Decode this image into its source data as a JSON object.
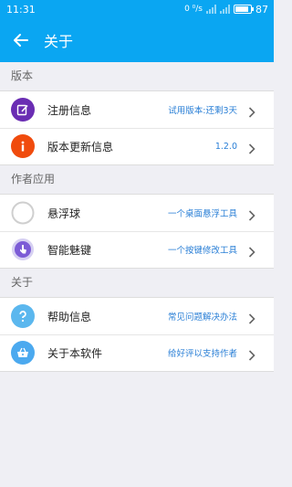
{
  "status_bar": {
    "time": "11:31",
    "net_speed": "0 ⁰/s",
    "battery": "87",
    "battery_level": 0.87
  },
  "app_bar": {
    "title": "关于"
  },
  "sections": [
    {
      "header": "版本",
      "items": [
        {
          "label": "注册信息",
          "value": "试用版本:还剩3天",
          "icon": "edit-icon",
          "color": "#6a2db3"
        },
        {
          "label": "版本更新信息",
          "value": "1.2.0",
          "icon": "info-icon",
          "color": "#f04b0d"
        }
      ]
    },
    {
      "header": "作者应用",
      "items": [
        {
          "label": "悬浮球",
          "value": "一个桌面悬浮工具",
          "icon": "floating-ball-icon",
          "color": "#d8d8d8"
        },
        {
          "label": "智能魅键",
          "value": "一个按键修改工具",
          "icon": "touch-key-icon",
          "color": "#7c5cd6"
        }
      ]
    },
    {
      "header": "关于",
      "items": [
        {
          "label": "帮助信息",
          "value": "常见问题解决办法",
          "icon": "help-icon",
          "color": "#5bb7ee"
        },
        {
          "label": "关于本软件",
          "value": "给好评以支持作者",
          "icon": "basket-icon",
          "color": "#4ba9ef"
        }
      ]
    }
  ]
}
